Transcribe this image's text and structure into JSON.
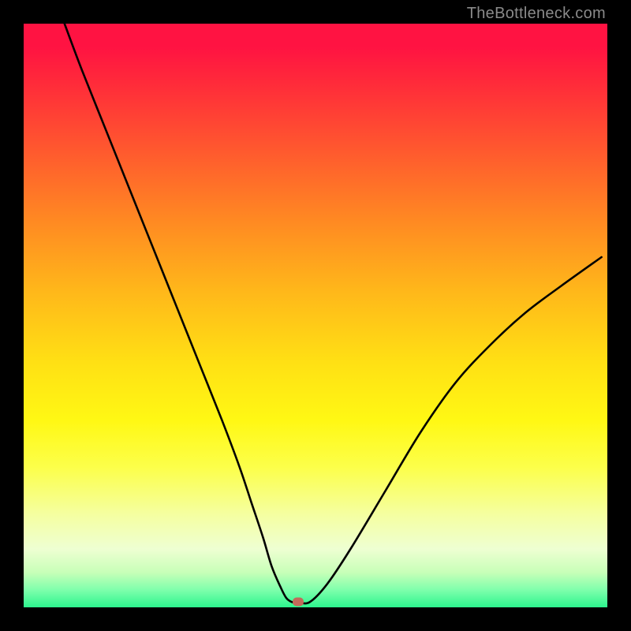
{
  "watermark": "TheBottleneck.com",
  "chart_data": {
    "type": "line",
    "title": "",
    "xlabel": "",
    "ylabel": "",
    "xlim": [
      0,
      100
    ],
    "ylim": [
      0,
      100
    ],
    "grid": false,
    "legend": false,
    "series": [
      {
        "name": "bottleneck-curve",
        "x": [
          7,
          10,
          14,
          18,
          22,
          26,
          30,
          34,
          37,
          39,
          41,
          42.5,
          44,
          45,
          46,
          47,
          49,
          52,
          56,
          62,
          68,
          74,
          80,
          86,
          92,
          99
        ],
        "y": [
          100,
          92,
          82,
          72,
          62,
          52,
          42,
          32,
          24,
          18,
          12,
          7,
          3.5,
          1.6,
          0.9,
          0.9,
          0.9,
          4,
          10,
          20,
          30,
          38.5,
          45,
          50.5,
          55,
          60
        ]
      }
    ],
    "marker": {
      "x": 47,
      "y": 0.9,
      "color": "#c36a5a"
    },
    "background_gradient": {
      "direction": "vertical",
      "stops": [
        {
          "pos": 0.0,
          "color": "#ff1342"
        },
        {
          "pos": 0.5,
          "color": "#ffd816"
        },
        {
          "pos": 0.9,
          "color": "#eeffd2"
        },
        {
          "pos": 1.0,
          "color": "#2cf58e"
        }
      ]
    }
  }
}
